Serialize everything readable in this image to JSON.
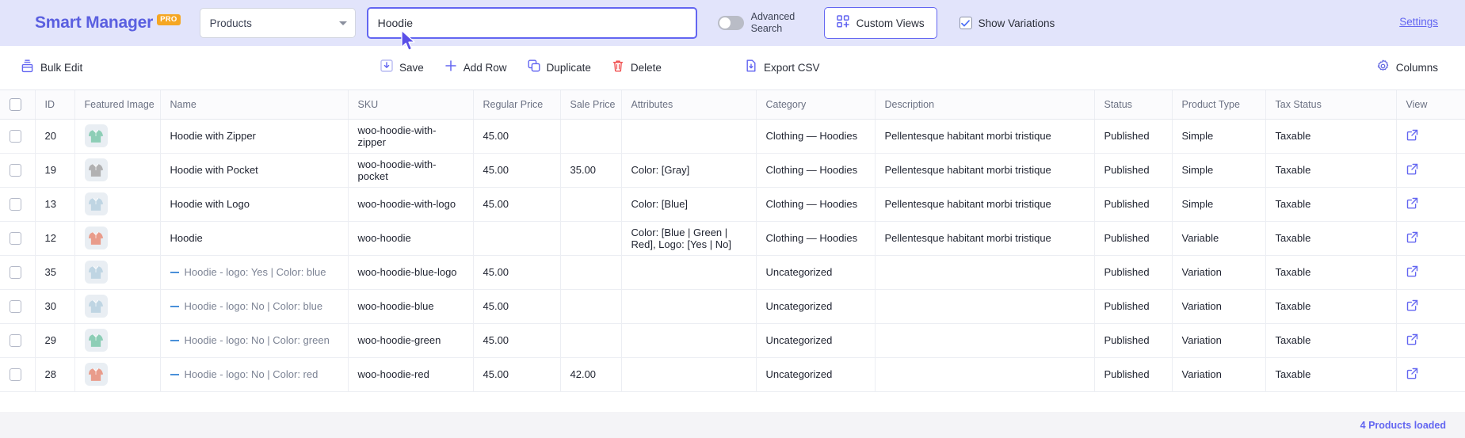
{
  "header": {
    "brand": "Smart Manager",
    "brand_badge": "PRO",
    "entity_select": {
      "value": "Products",
      "icon": "chevron-down-icon"
    },
    "search": {
      "value": "Hoodie",
      "placeholder": "Search"
    },
    "advanced_search": {
      "label": "Advanced Search",
      "enabled": false
    },
    "custom_views": {
      "label": "Custom Views",
      "icon": "grid-plus-icon"
    },
    "show_variations": {
      "label": "Show Variations",
      "checked": true
    },
    "settings": "Settings",
    "accent": "#6366f1",
    "background": "#e2e4fb"
  },
  "toolbar": {
    "bulk_edit": {
      "label": "Bulk Edit",
      "icon": "bulk-edit-icon"
    },
    "save": {
      "label": "Save",
      "icon": "save-icon"
    },
    "add_row": {
      "label": "Add Row",
      "icon": "plus-icon"
    },
    "duplicate": {
      "label": "Duplicate",
      "icon": "copy-icon"
    },
    "delete": {
      "label": "Delete",
      "icon": "trash-icon"
    },
    "export_csv": {
      "label": "Export CSV",
      "icon": "export-icon"
    },
    "columns": {
      "label": "Columns",
      "icon": "gear-icon"
    }
  },
  "table": {
    "columns": [
      "ID",
      "Featured Image",
      "Name",
      "SKU",
      "Regular Price",
      "Sale Price",
      "Attributes",
      "Category",
      "Description",
      "Status",
      "Product Type",
      "Tax Status",
      "View"
    ],
    "rows": [
      {
        "id": "20",
        "thumb": "#7fc9ad",
        "name": "Hoodie with Zipper",
        "variation": false,
        "sku": "woo-hoodie-with-zipper",
        "regular_price": "45.00",
        "sale_price": "",
        "attributes": "",
        "category": "Clothing — Hoodies",
        "description": "Pellentesque habitant morbi tristique",
        "status": "Published",
        "product_type": "Simple",
        "tax_status": "Taxable"
      },
      {
        "id": "19",
        "thumb": "#a8a8a8",
        "name": "Hoodie with Pocket",
        "variation": false,
        "sku": "woo-hoodie-with-pocket",
        "regular_price": "45.00",
        "sale_price": "35.00",
        "attributes": "Color: [Gray]",
        "category": "Clothing — Hoodies",
        "description": "Pellentesque habitant morbi tristique",
        "status": "Published",
        "product_type": "Simple",
        "tax_status": "Taxable"
      },
      {
        "id": "13",
        "thumb": "#b8d2e0",
        "name": "Hoodie with Logo",
        "variation": false,
        "sku": "woo-hoodie-with-logo",
        "regular_price": "45.00",
        "sale_price": "",
        "attributes": "Color: [Blue]",
        "category": "Clothing — Hoodies",
        "description": "Pellentesque habitant morbi tristique",
        "status": "Published",
        "product_type": "Simple",
        "tax_status": "Taxable"
      },
      {
        "id": "12",
        "thumb": "#e8917c",
        "name": "Hoodie",
        "variation": false,
        "sku": "woo-hoodie",
        "regular_price": "",
        "sale_price": "",
        "attributes": "Color: [Blue | Green | Red], Logo: [Yes | No]",
        "category": "Clothing — Hoodies",
        "description": "Pellentesque habitant morbi tristique",
        "status": "Published",
        "product_type": "Variable",
        "tax_status": "Taxable"
      },
      {
        "id": "35",
        "thumb": "#b8d2e0",
        "name": "Hoodie - logo: Yes | Color: blue",
        "variation": true,
        "sku": "woo-hoodie-blue-logo",
        "regular_price": "45.00",
        "sale_price": "",
        "attributes": "",
        "category": "Uncategorized",
        "description": "",
        "status": "Published",
        "product_type": "Variation",
        "tax_status": "Taxable"
      },
      {
        "id": "30",
        "thumb": "#b8d2e0",
        "name": "Hoodie - logo: No | Color: blue",
        "variation": true,
        "sku": "woo-hoodie-blue",
        "regular_price": "45.00",
        "sale_price": "",
        "attributes": "",
        "category": "Uncategorized",
        "description": "",
        "status": "Published",
        "product_type": "Variation",
        "tax_status": "Taxable"
      },
      {
        "id": "29",
        "thumb": "#7fc9ad",
        "name": "Hoodie - logo: No | Color: green",
        "variation": true,
        "sku": "woo-hoodie-green",
        "regular_price": "45.00",
        "sale_price": "",
        "attributes": "",
        "category": "Uncategorized",
        "description": "",
        "status": "Published",
        "product_type": "Variation",
        "tax_status": "Taxable"
      },
      {
        "id": "28",
        "thumb": "#e8917c",
        "name": "Hoodie - logo: No | Color: red",
        "variation": true,
        "sku": "woo-hoodie-red",
        "regular_price": "45.00",
        "sale_price": "42.00",
        "attributes": "",
        "category": "Uncategorized",
        "description": "",
        "status": "Published",
        "product_type": "Variation",
        "tax_status": "Taxable"
      }
    ]
  },
  "footer": {
    "count_label": "4 Products loaded"
  }
}
